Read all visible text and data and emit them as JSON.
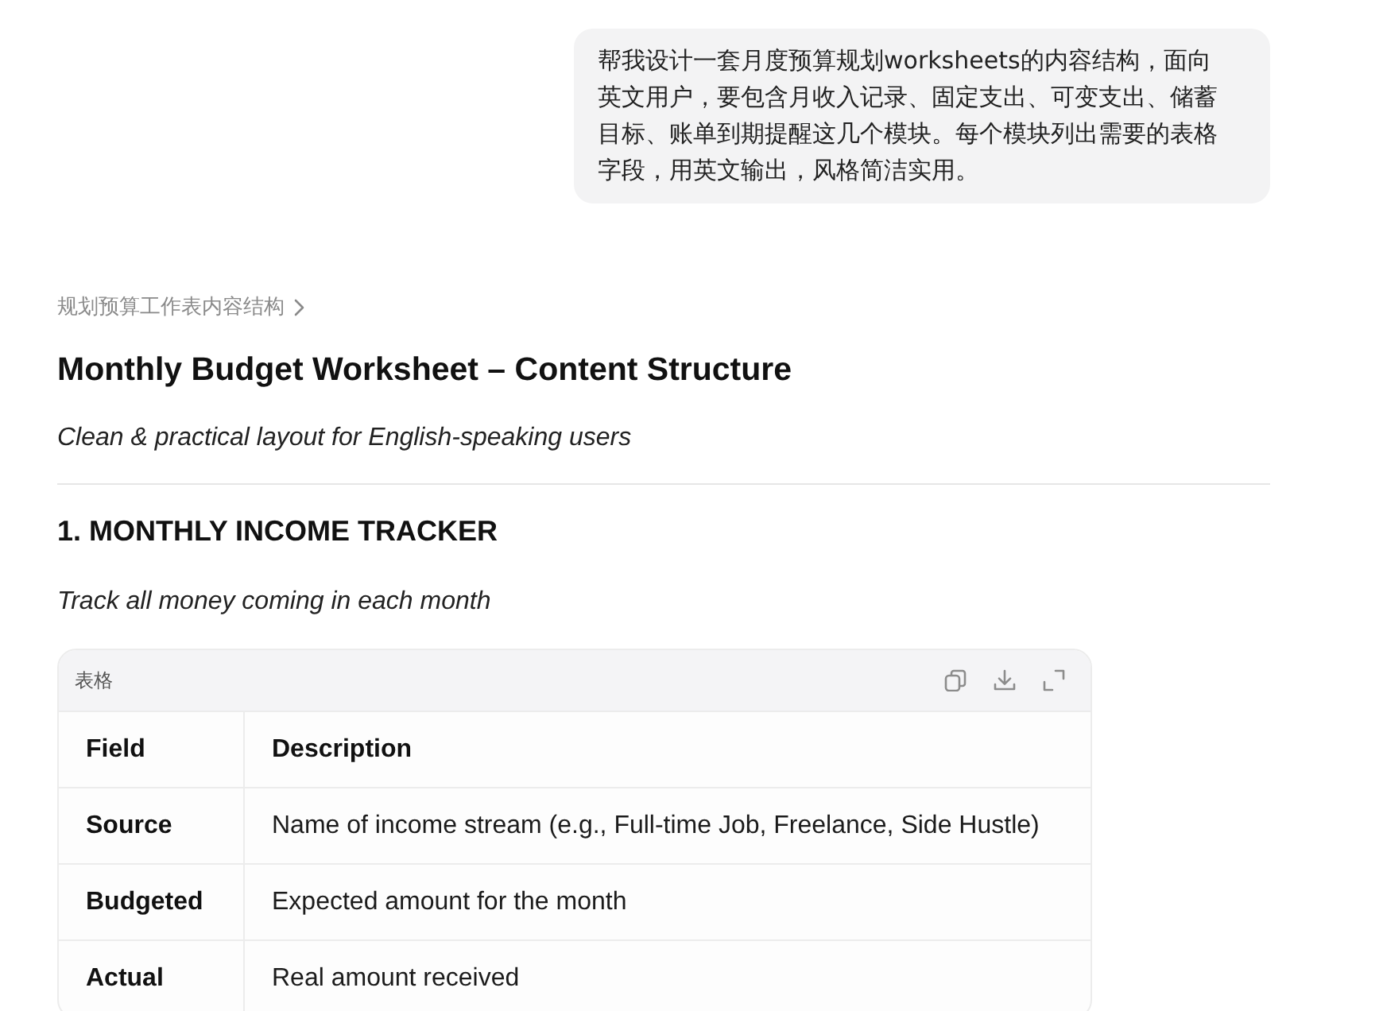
{
  "user_message": {
    "text": "帮我设计一套月度预算规划worksheets的内容结构，面向英文用户，要包含月收入记录、固定支出、可变支出、储蓄目标、账单到期提醒这几个模块。每个模块列出需要的表格字段，用英文输出，风格简洁实用。"
  },
  "response": {
    "breadcrumb": "规划预算工作表内容结构",
    "title": "Monthly Budget Worksheet – Content Structure",
    "subtitle": "Clean & practical layout for English-speaking users",
    "sections": [
      {
        "heading": "1. MONTHLY INCOME TRACKER",
        "description": "Track all money coming in each month",
        "table": {
          "label": "表格",
          "columns": [
            "Field",
            "Description"
          ],
          "rows": [
            [
              "Source",
              "Name of income stream (e.g., Full-time Job, Freelance, Side Hustle)"
            ],
            [
              "Budgeted",
              "Expected amount for the month"
            ],
            [
              "Actual",
              "Real amount received"
            ]
          ]
        }
      }
    ]
  }
}
